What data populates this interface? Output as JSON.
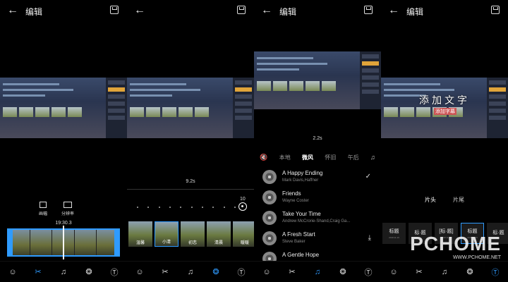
{
  "screens": [
    {
      "title": "编辑",
      "timecode": "19:30.3",
      "tools": [
        {
          "label": "画幅"
        },
        {
          "label": "分辨率"
        }
      ],
      "nav": [
        "mascot-icon",
        "scissors-icon",
        "music-note-icon",
        "filter-icon",
        "text-icon"
      ],
      "active_nav": 1
    },
    {
      "title": "",
      "duration": "9.2s",
      "intensity": "10",
      "filters": [
        "温馨",
        "小清",
        "初恋",
        "清晨",
        "暖暖"
      ],
      "selected_filter": 1,
      "active_nav": 3
    },
    {
      "title": "编辑",
      "duration": "2.2s",
      "categories": [
        "本地",
        "微风",
        "怀旧",
        "午后"
      ],
      "active_category": 1,
      "songs": [
        {
          "name": "A Happy Ending",
          "artist": "Mark Davis,Haffner",
          "action": "✓"
        },
        {
          "name": "Friends",
          "artist": "Wayne Coster",
          "action": ""
        },
        {
          "name": "Take Your Time",
          "artist": "Andrew McCrorie-Shand,Craig Ga...",
          "action": ""
        },
        {
          "name": "A Fresh Start",
          "artist": "Steve Baker",
          "action": "⤓"
        },
        {
          "name": "A Gentle Hope",
          "artist": "",
          "action": ""
        }
      ],
      "active_nav": 2
    },
    {
      "title": "编辑",
      "overlay_title": "添加文字",
      "overlay_sub": "添加字幕",
      "head_tail": [
        "片头",
        "片尾"
      ],
      "active_head_tail": 0,
      "templates": [
        {
          "label": "标题",
          "sub": "2018.11.16"
        },
        {
          "label": "标·题",
          "sub": ""
        },
        {
          "label": "[标·题]",
          "sub": "2018.11.16"
        },
        {
          "label": "标题",
          "sub": "2018.11.16"
        },
        {
          "label": "标·题",
          "sub": ""
        }
      ],
      "selected_template": 3,
      "watermark": {
        "brand": "PCHOME",
        "url": "WWW.PCHOME.NET"
      }
    }
  ],
  "colors": {
    "accent": "#2f9bff",
    "background": "#000000"
  }
}
